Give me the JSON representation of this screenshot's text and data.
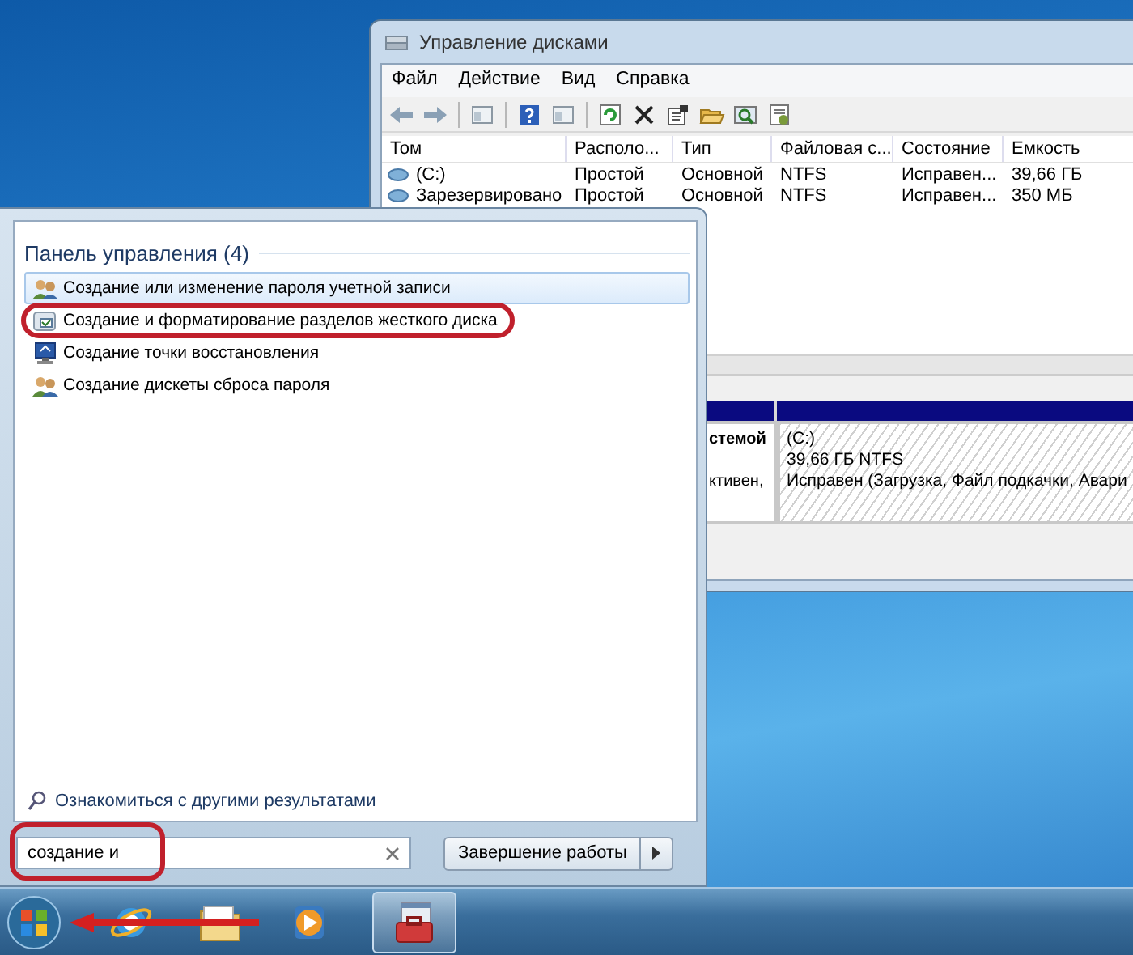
{
  "disk_window": {
    "title": "Управление дисками",
    "menu": [
      "Файл",
      "Действие",
      "Вид",
      "Справка"
    ],
    "toolbar": [
      {
        "kind": "back"
      },
      {
        "kind": "forward"
      },
      {
        "kind": "sep"
      },
      {
        "kind": "pane"
      },
      {
        "kind": "sep"
      },
      {
        "kind": "help"
      },
      {
        "kind": "pane"
      },
      {
        "kind": "sep"
      },
      {
        "kind": "refresh"
      },
      {
        "kind": "delete"
      },
      {
        "kind": "properties"
      },
      {
        "kind": "open"
      },
      {
        "kind": "zoom"
      },
      {
        "kind": "settings"
      }
    ],
    "table": {
      "columns": [
        "Том",
        "Располо...",
        "Тип",
        "Файловая с...",
        "Состояние",
        "Емкость"
      ],
      "rows": [
        [
          "(C:)",
          "Простой",
          "Основной",
          "NTFS",
          "Исправен...",
          "39,66 ГБ"
        ],
        [
          "Зарезервировано",
          "Простой",
          "Основной",
          "NTFS",
          "Исправен...",
          "350 МБ"
        ]
      ]
    },
    "partitions": [
      {
        "lines": [
          "стемой",
          "ктивен,"
        ],
        "kind": "plain"
      },
      {
        "lines": [
          "(C:)",
          "39,66 ГБ NTFS",
          "Исправен (Загрузка, Файл подкачки, Авари"
        ],
        "kind": "hatched"
      }
    ]
  },
  "start_menu": {
    "section_title": "Панель управления (4)",
    "results": [
      {
        "label": "Создание или изменение пароля учетной записи",
        "kind": "accounts",
        "selected": true,
        "circled": false
      },
      {
        "label": "Создание и форматирование разделов жесткого диска",
        "kind": "partition",
        "selected": false,
        "circled": true
      },
      {
        "label": "Создание точки восстановления",
        "kind": "restore",
        "selected": false,
        "circled": false
      },
      {
        "label": "Создание дискеты сброса пароля",
        "kind": "accounts",
        "selected": false,
        "circled": false
      }
    ],
    "more_results": "Ознакомиться с другими результатами",
    "search": {
      "value": "создание и",
      "circled": true
    },
    "shutdown_button": "Завершение работы"
  },
  "taskbar": {
    "start_pointed": true,
    "items": [
      {
        "kind": "browser",
        "selected": false
      },
      {
        "kind": "folder",
        "selected": false
      },
      {
        "kind": "media",
        "selected": false
      },
      {
        "kind": "toolbox",
        "selected": true
      }
    ]
  }
}
